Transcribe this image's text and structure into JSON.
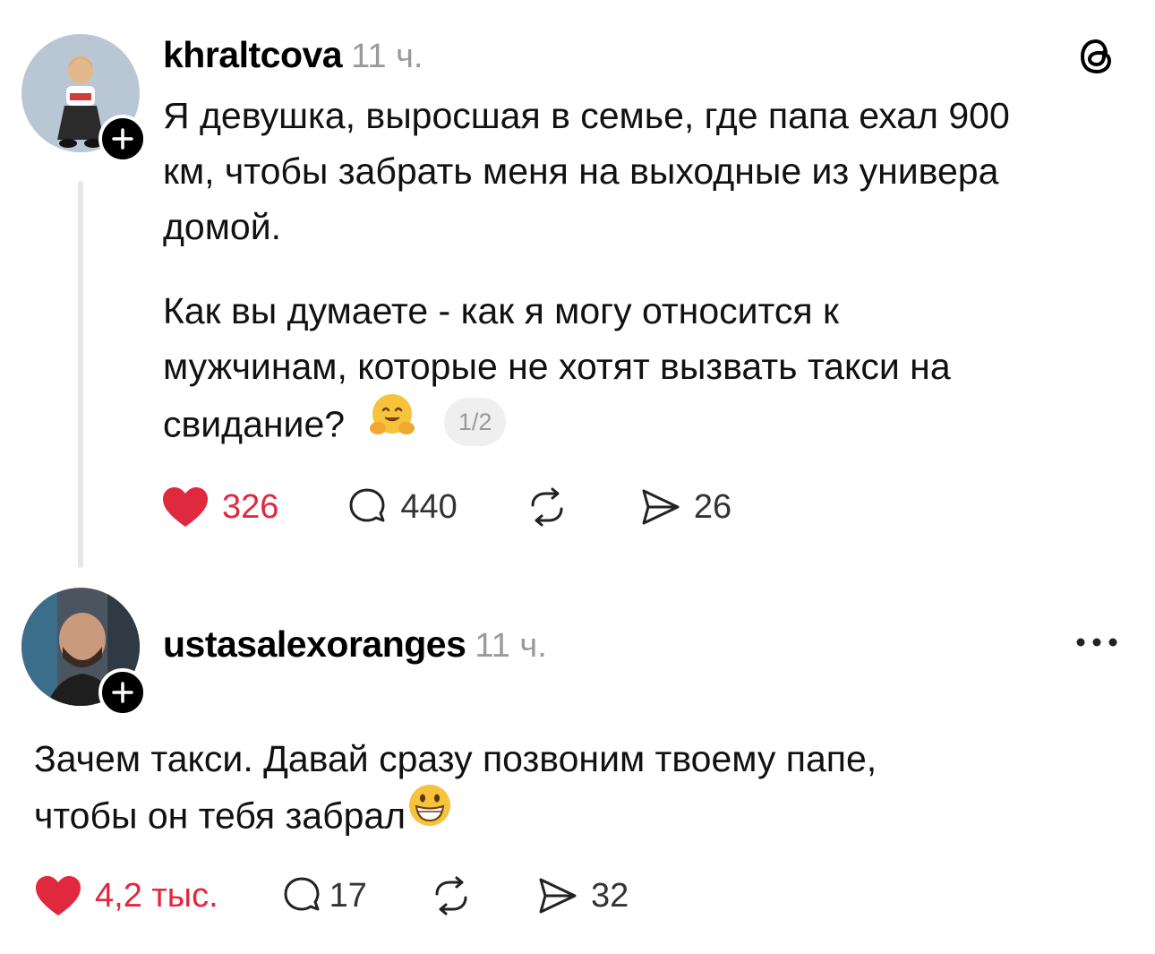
{
  "post": {
    "username": "khraltcova",
    "time": "11 ч.",
    "lines_p1": [
      "Я девушка, выросшая в семье, где папа ехал 900",
      "км, чтобы забрать меня на выходные из универа",
      "домой."
    ],
    "lines_p2": [
      "Как вы думаете - как я могу относится к",
      "мужчинам, которые не хотят вызвать такси на",
      "свидание?"
    ],
    "page_indicator": "1/2",
    "likes": "326",
    "replies": "440",
    "shares": "26",
    "header_icon": "threads-logo-icon",
    "emoji_name": "hugging-face-emoji"
  },
  "reply": {
    "username": "ustasalexoranges",
    "time": "11 ч.",
    "lines": [
      "Зачем такси. Давай сразу позвоним твоему папе,",
      "чтобы он тебя забрал"
    ],
    "likes": "4,2 тыс.",
    "replies": "17",
    "shares": "32",
    "menu_icon": "more-options-icon",
    "emoji_name": "grinning-face-emoji"
  },
  "colors": {
    "like": "#e0283e",
    "muted": "#9a9a9a",
    "thread_line": "#e6e6e6"
  }
}
